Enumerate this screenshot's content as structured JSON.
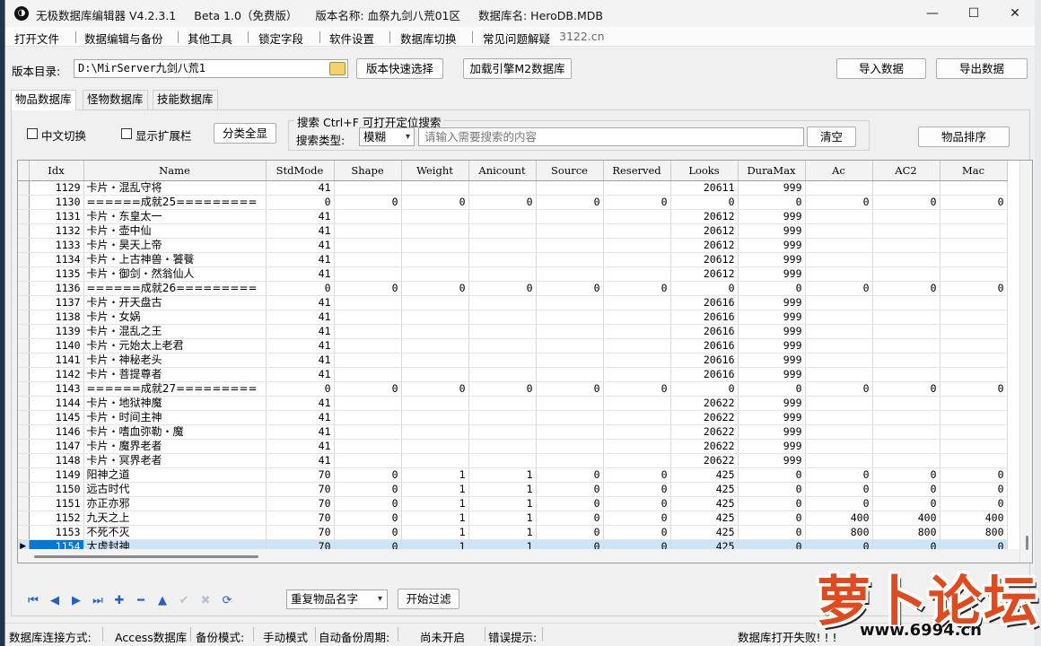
{
  "titlebar": {
    "app_name": "无极数据库编辑器 V4.2.3.1",
    "edition": "Beta 1.0（免费版）",
    "version_label": "版本名称: 血祭九剑八荒01区",
    "db_label": "数据库名: HeroDB.MDB",
    "minimize": "—",
    "maximize": "☐",
    "close": "✕"
  },
  "menu": {
    "items": [
      "打开文件",
      "数据编辑与备份",
      "其他工具",
      "锁定字段",
      "软件设置",
      "数据库切换",
      "常见问题解疑"
    ],
    "site": "3122.cn"
  },
  "toolbar": {
    "dir_label": "版本目录:",
    "dir_value": "D:\\MirServer九剑八荒1",
    "quick_select": "版本快速选择",
    "load_engine": "加载引擎M2数据库",
    "import": "导入数据",
    "export": "导出数据"
  },
  "tabs": [
    "物品数据库",
    "怪物数据库",
    "技能数据库"
  ],
  "filters": {
    "chinese_switch": "中文切换",
    "show_ext": "显示扩展栏",
    "show_all": "分类全显",
    "search_legend": "搜索  Ctrl+F 可打开定位搜索",
    "search_type_label": "搜索类型:",
    "search_type_value": "模糊",
    "search_placeholder": "请输入需要搜索的内容",
    "clear": "清空",
    "sort": "物品排序"
  },
  "table": {
    "columns": [
      "Idx",
      "Name",
      "StdMode",
      "Shape",
      "Weight",
      "Anicount",
      "Source",
      "Reserved",
      "Looks",
      "DuraMax",
      "Ac",
      "AC2",
      "Mac"
    ],
    "rows": [
      [
        "1129",
        "卡片・混乱守将",
        "41",
        "",
        "",
        "",
        "",
        "",
        "20611",
        "999",
        "",
        "",
        ""
      ],
      [
        "1130",
        "======成就25=========",
        "0",
        "0",
        "0",
        "0",
        "0",
        "0",
        "0",
        "0",
        "0",
        "0",
        "0"
      ],
      [
        "1131",
        "卡片・东皇太一",
        "41",
        "",
        "",
        "",
        "",
        "",
        "20612",
        "999",
        "",
        "",
        ""
      ],
      [
        "1132",
        "卡片・壶中仙",
        "41",
        "",
        "",
        "",
        "",
        "",
        "20612",
        "999",
        "",
        "",
        ""
      ],
      [
        "1133",
        "卡片・昊天上帝",
        "41",
        "",
        "",
        "",
        "",
        "",
        "20612",
        "999",
        "",
        "",
        ""
      ],
      [
        "1134",
        "卡片・上古神兽・饕餮",
        "41",
        "",
        "",
        "",
        "",
        "",
        "20612",
        "999",
        "",
        "",
        ""
      ],
      [
        "1135",
        "卡片・御剑・然翁仙人",
        "41",
        "",
        "",
        "",
        "",
        "",
        "20612",
        "999",
        "",
        "",
        ""
      ],
      [
        "1136",
        "======成就26=========",
        "0",
        "0",
        "0",
        "0",
        "0",
        "0",
        "0",
        "0",
        "0",
        "0",
        "0"
      ],
      [
        "1137",
        "卡片・开天盘古",
        "41",
        "",
        "",
        "",
        "",
        "",
        "20616",
        "999",
        "",
        "",
        ""
      ],
      [
        "1138",
        "卡片・女娲",
        "41",
        "",
        "",
        "",
        "",
        "",
        "20616",
        "999",
        "",
        "",
        ""
      ],
      [
        "1139",
        "卡片・混乱之王",
        "41",
        "",
        "",
        "",
        "",
        "",
        "20616",
        "999",
        "",
        "",
        ""
      ],
      [
        "1140",
        "卡片・元始太上老君",
        "41",
        "",
        "",
        "",
        "",
        "",
        "20616",
        "999",
        "",
        "",
        ""
      ],
      [
        "1141",
        "卡片・神秘老头",
        "41",
        "",
        "",
        "",
        "",
        "",
        "20616",
        "999",
        "",
        "",
        ""
      ],
      [
        "1142",
        "卡片・菩提尊者",
        "41",
        "",
        "",
        "",
        "",
        "",
        "20616",
        "999",
        "",
        "",
        ""
      ],
      [
        "1143",
        "======成就27=========",
        "0",
        "0",
        "0",
        "0",
        "0",
        "0",
        "0",
        "0",
        "0",
        "0",
        "0"
      ],
      [
        "1144",
        "卡片・地狱神魔",
        "41",
        "",
        "",
        "",
        "",
        "",
        "20622",
        "999",
        "",
        "",
        ""
      ],
      [
        "1145",
        "卡片・时间主神",
        "41",
        "",
        "",
        "",
        "",
        "",
        "20622",
        "999",
        "",
        "",
        ""
      ],
      [
        "1146",
        "卡片・嗜血弥勒・魔",
        "41",
        "",
        "",
        "",
        "",
        "",
        "20622",
        "999",
        "",
        "",
        ""
      ],
      [
        "1147",
        "卡片・魔界老者",
        "41",
        "",
        "",
        "",
        "",
        "",
        "20622",
        "999",
        "",
        "",
        ""
      ],
      [
        "1148",
        "卡片・冥界老者",
        "41",
        "",
        "",
        "",
        "",
        "",
        "20622",
        "999",
        "",
        "",
        ""
      ],
      [
        "1149",
        "阳神之道",
        "70",
        "0",
        "1",
        "1",
        "0",
        "0",
        "425",
        "0",
        "0",
        "0",
        "0"
      ],
      [
        "1150",
        "远古时代",
        "70",
        "0",
        "1",
        "1",
        "0",
        "0",
        "425",
        "0",
        "0",
        "0",
        "0"
      ],
      [
        "1151",
        "亦正亦邪",
        "70",
        "0",
        "1",
        "1",
        "0",
        "0",
        "425",
        "0",
        "0",
        "0",
        "0"
      ],
      [
        "1152",
        "九天之上",
        "70",
        "0",
        "1",
        "1",
        "0",
        "0",
        "425",
        "0",
        "400",
        "400",
        "400"
      ],
      [
        "1153",
        "不死不灭",
        "70",
        "0",
        "1",
        "1",
        "0",
        "0",
        "425",
        "0",
        "800",
        "800",
        "800"
      ],
      [
        "1154",
        "太虚封神",
        "70",
        "0",
        "1",
        "1",
        "0",
        "0",
        "425",
        "0",
        "0",
        "0",
        "0"
      ]
    ],
    "selected_index": 25,
    "row_pointer": "▶"
  },
  "navigator": {
    "icons": [
      "first-icon",
      "prior-icon",
      "next-icon",
      "last-icon",
      "insert-icon",
      "delete-icon",
      "edit-icon",
      "post-icon",
      "cancel-icon",
      "refresh-icon"
    ],
    "glyphs": [
      "⏮",
      "◀",
      "▶",
      "⏭",
      "✚",
      "━",
      "▲",
      "✔",
      "✖",
      "⟳"
    ],
    "filter_combo": "重复物品名字",
    "filter_combo_arrow": "▾",
    "start_filter": "开始过滤"
  },
  "status": {
    "conn_label": "数据库连接方式:",
    "conn_value": "Access数据库",
    "backup_label": "备份模式:",
    "backup_value": "手动模式",
    "auto_label": "自动备份周期:",
    "auto_value": "尚未开启",
    "error_label": "错误提示:",
    "error_value": "数据库打开失败! ! !"
  },
  "watermark": {
    "text": "萝卜论坛",
    "url": "www.6994.cn"
  },
  "colors": {
    "selection": "#0078d7",
    "selection_row": "#cce4f7",
    "nav_blue": "#1f5fd1",
    "watermark": "#e04a1d"
  }
}
